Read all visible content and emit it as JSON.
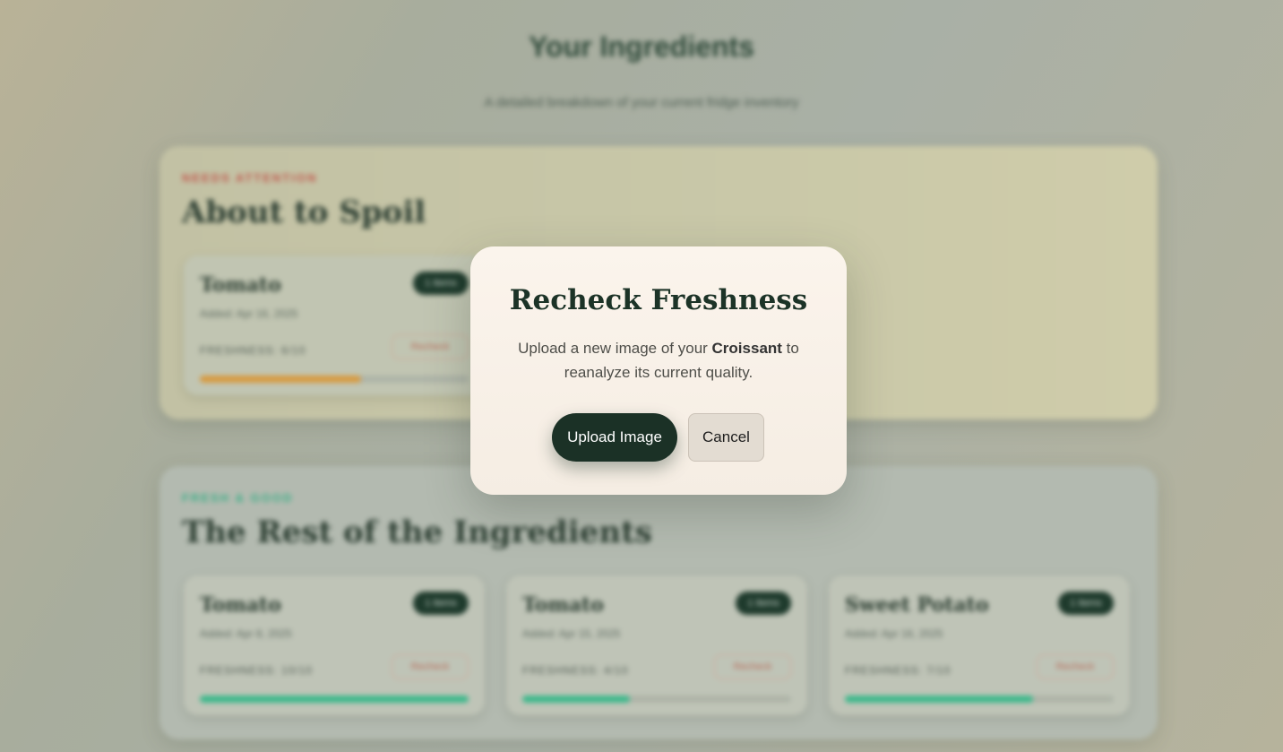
{
  "background": {
    "title": "Your Ingredients",
    "subtitle": "A detailed breakdown of your current fridge inventory",
    "attention_section": {
      "kicker": "NEEDS ATTENTION",
      "title": "About to Spoil",
      "cards": [
        {
          "name": "Tomato",
          "pill": "1 items",
          "added": "Added: Apr 16, 2025",
          "freshness": "FRESHNESS: 6/10",
          "recheck": "Recheck",
          "freshness_value": 0.6,
          "bar_color": "#d79a3f"
        }
      ]
    },
    "fresh_section": {
      "kicker": "FRESH & GOOD",
      "title": "The Rest of the Ingredients",
      "cards": [
        {
          "name": "Tomato",
          "pill": "1 items",
          "added": "Added: Apr 8, 2025",
          "freshness": "FRESHNESS: 10/10",
          "recheck": "Recheck",
          "freshness_value": 1.0,
          "bar_color": "#3bb88b"
        },
        {
          "name": "Tomato",
          "pill": "1 items",
          "added": "Added: Apr 15, 2025",
          "freshness": "FRESHNESS: 4/10",
          "recheck": "Recheck",
          "freshness_value": 0.4,
          "bar_color": "#3bb88b"
        },
        {
          "name": "Sweet Potato",
          "pill": "1 items",
          "added": "Added: Apr 16, 2025",
          "freshness": "FRESHNESS: 7/10",
          "recheck": "Recheck",
          "freshness_value": 0.7,
          "bar_color": "#3bb88b"
        }
      ]
    }
  },
  "modal": {
    "title": "Recheck Freshness",
    "body_prefix": "Upload a new image of your ",
    "item_name": "Croissant",
    "body_suffix": " to reanalyze its current quality.",
    "upload_label": "Upload Image",
    "cancel_label": "Cancel"
  }
}
